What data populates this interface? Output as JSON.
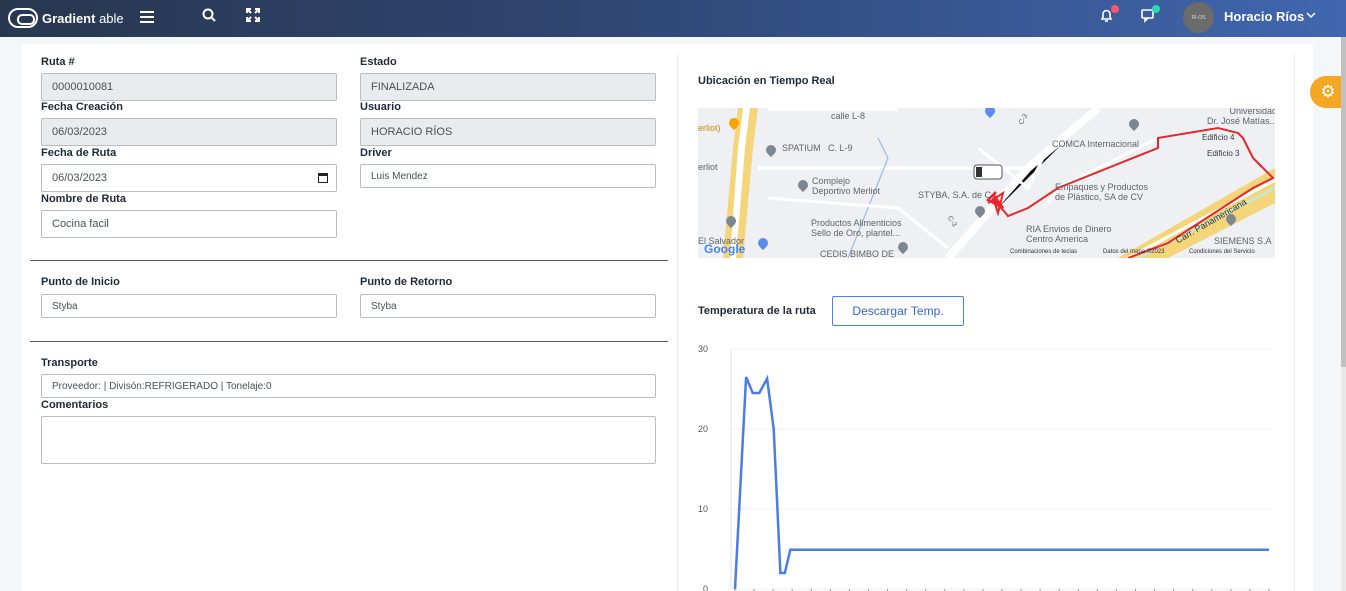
{
  "topbar": {
    "brand_bold": "Gradient",
    "brand_light": " able",
    "user_name": "Horacio Ríos",
    "avatar_text": "RÍ-OS",
    "icons": [
      "menu-icon",
      "search-icon",
      "fullscreen-icon",
      "bell-icon",
      "chat-icon",
      "chevron-down-icon",
      "gear-icon"
    ]
  },
  "form": {
    "ruta_label": "Ruta #",
    "ruta_value": "0000010081",
    "estado_label": "Estado",
    "estado_value": "FINALIZADA",
    "fecha_creacion_label": "Fecha Creación",
    "fecha_creacion_value": "06/03/2023",
    "usuario_label": "Usuario",
    "usuario_value": "HORACIO RÍOS",
    "fecha_ruta_label": "Fecha de Ruta",
    "fecha_ruta_value": "06/03/2023",
    "driver_label": "Driver",
    "driver_value": "Luis Mendez",
    "nombre_ruta_label": "Nombre de Ruta",
    "nombre_ruta_value": "Cocina facil",
    "punto_inicio_label": "Punto de Inicio",
    "punto_inicio_value": "Styba",
    "punto_retorno_label": "Punto de Retorno",
    "punto_retorno_value": "Styba",
    "transporte_label": "Transporte",
    "transporte_value": "Proveedor: | Divisón:REFRIGERADO | Tonelaje:0",
    "comentarios_label": "Comentarios",
    "comentarios_value": ""
  },
  "map": {
    "title": "Ubicación en Tiempo Real",
    "places": {
      "calle_l8": "calle L-8",
      "spatium": "SPATIUM",
      "calle_l9": "C. L-9",
      "merliot_top": "erliot)",
      "merliot_side": "erliot",
      "complejo": "Complejo\nDeportivo Merliot",
      "productos": "Productos Alimenticios\nSello de Oro, plantel...",
      "el_salvador": "El Salvador",
      "cedis": "CEDIS BIMBO DE",
      "styba": "STYBA, S.A. de C.",
      "comca": "COMCA Internacional",
      "empaques": "Empaques y Productos\nde Plástico, SA de CV",
      "ria": "RIA Envios de Dinero\nCentro America",
      "siemens": "SIEMENS S.A",
      "universidad": "Universidad\nDr. José Matías...",
      "edificio4": "Edificio 4",
      "edificio3": "Edificio 3",
      "carr": "Carr. Panamericana",
      "c3_a": "C-3",
      "c3_b": "C-3"
    },
    "footer": {
      "shortcuts": "Combinaciones de teclas",
      "mapdata": "Datos del mapa ©2023",
      "terms": "Condiciones del Servicio"
    },
    "google": "Google"
  },
  "temperature": {
    "title": "Temperatura de la ruta",
    "download_button": "Descargar Temp."
  },
  "colors": {
    "accent": "#4680ff",
    "line": "#4a7de8",
    "route": "#e8262c",
    "settings": "#f5a623"
  },
  "chart_data": {
    "type": "line",
    "title": "",
    "xlabel": "",
    "ylabel": "",
    "ylim": [
      0,
      30
    ],
    "yticks": [
      0,
      10,
      20,
      30
    ],
    "grid": true,
    "legend": "none",
    "series": [
      {
        "values": [
          0,
          26.5,
          24.5,
          24.5,
          26.3,
          20,
          2,
          2,
          4.9,
          4.9,
          4.9,
          4.9,
          4.9,
          4.9,
          4.9,
          4.9,
          4.9,
          4.9,
          4.9,
          4.9,
          4.9,
          4.9,
          4.9,
          4.9,
          4.9,
          4.9,
          4.9,
          4.9,
          4.9
        ]
      }
    ]
  }
}
